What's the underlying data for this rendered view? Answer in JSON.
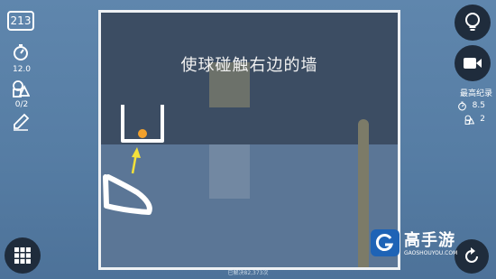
{
  "level": {
    "number": "213"
  },
  "stats": {
    "time_value": "12.0",
    "shapes_value": "0/2"
  },
  "game": {
    "hint": "使球碰触右边的墙"
  },
  "best": {
    "title": "最高纪录",
    "time": "8.5",
    "shapes": "2"
  },
  "footer": {
    "solved_text": "已解决82,373次"
  },
  "watermark": {
    "brand_cn": "高手游",
    "brand_en": "GAOSHOUYOU.COM"
  },
  "colors": {
    "ball": "#f2a12c",
    "drawn_line": "#ffffff",
    "hint_arrow": "#f4e13a",
    "button_bg": "#1f2c3c",
    "wall": "#7c7b68"
  },
  "icons": {
    "time": "stopwatch-icon",
    "shapes": "shapes-icon",
    "draw": "pencil-icon",
    "hint": "lightbulb-icon",
    "video": "video-camera-icon",
    "menu": "grid-menu-icon",
    "restart": "restart-icon"
  }
}
